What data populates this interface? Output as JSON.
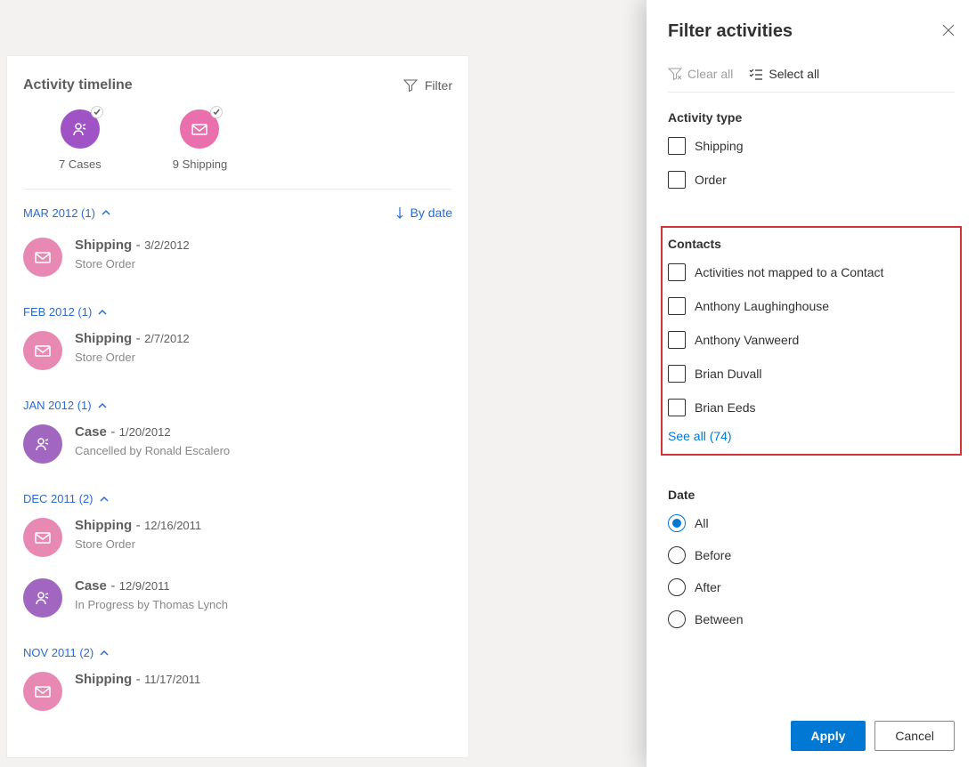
{
  "timeline": {
    "title": "Activity timeline",
    "filter_label": "Filter",
    "sort_label": "By date",
    "summary": [
      {
        "count": 7,
        "label": "Cases",
        "kind": "case"
      },
      {
        "count": 9,
        "label": "Shipping",
        "kind": "shipping"
      }
    ],
    "groups": [
      {
        "header": "MAR 2012 (1)",
        "items": [
          {
            "kind": "shipping",
            "title": "Shipping",
            "date": "3/2/2012",
            "sub": "Store Order"
          }
        ]
      },
      {
        "header": "FEB 2012 (1)",
        "items": [
          {
            "kind": "shipping",
            "title": "Shipping",
            "date": "2/7/2012",
            "sub": "Store Order"
          }
        ]
      },
      {
        "header": "JAN 2012 (1)",
        "items": [
          {
            "kind": "case",
            "title": "Case",
            "date": "1/20/2012",
            "sub": "Cancelled by Ronald Escalero"
          }
        ]
      },
      {
        "header": "DEC 2011 (2)",
        "items": [
          {
            "kind": "shipping",
            "title": "Shipping",
            "date": "12/16/2011",
            "sub": "Store Order"
          },
          {
            "kind": "case",
            "title": "Case",
            "date": "12/9/2011",
            "sub": "In Progress by Thomas Lynch"
          }
        ]
      },
      {
        "header": "NOV 2011 (2)",
        "items": [
          {
            "kind": "shipping",
            "title": "Shipping",
            "date": "11/17/2011",
            "sub": ""
          }
        ]
      }
    ]
  },
  "panel": {
    "title": "Filter activities",
    "clear_all": "Clear all",
    "select_all": "Select all",
    "activity_type_header": "Activity type",
    "activity_types": [
      "Shipping",
      "Order"
    ],
    "contacts_header": "Contacts",
    "contacts": [
      "Activities not mapped to a Contact",
      "Anthony Laughinghouse",
      "Anthony Vanweerd",
      "Brian Duvall",
      "Brian Eeds"
    ],
    "see_all": "See all (74)",
    "date_header": "Date",
    "date_options": [
      "All",
      "Before",
      "After",
      "Between"
    ],
    "date_selected": "All",
    "apply": "Apply",
    "cancel": "Cancel"
  }
}
